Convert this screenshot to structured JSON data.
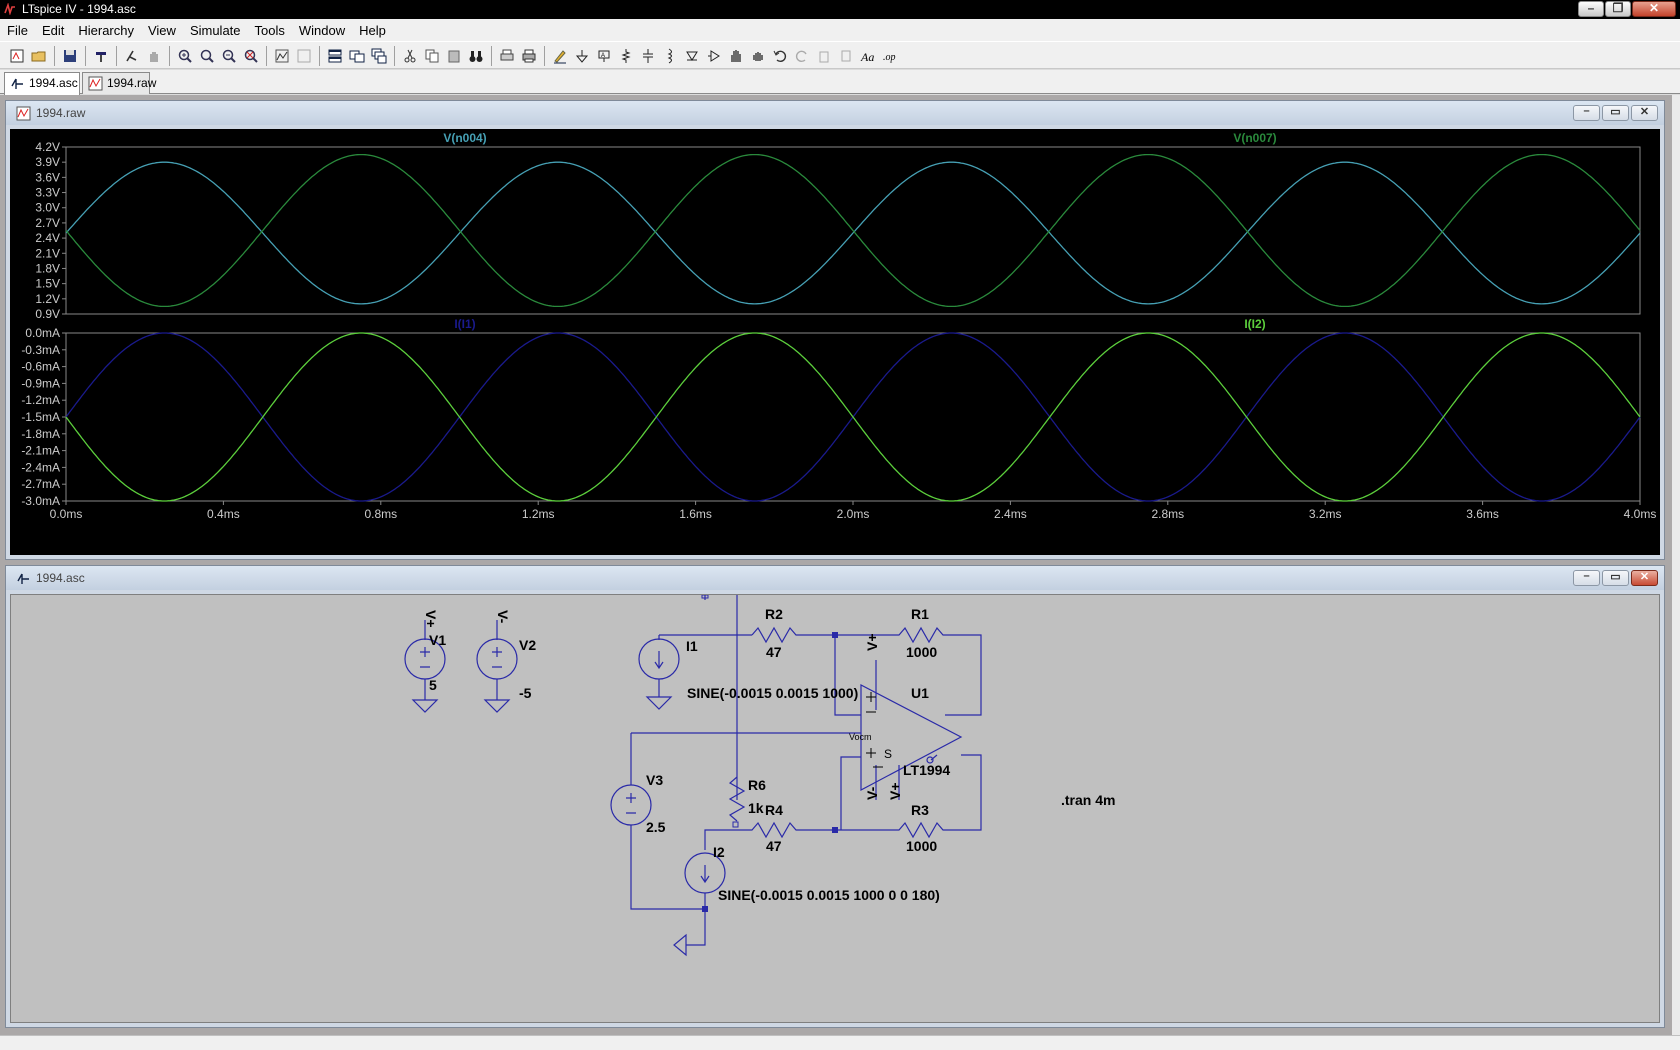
{
  "window": {
    "title": "LTspice IV - 1994.asc"
  },
  "menu": [
    "File",
    "Edit",
    "Hierarchy",
    "View",
    "Simulate",
    "Tools",
    "Window",
    "Help"
  ],
  "tabs": [
    {
      "label": "1994.asc",
      "active": true
    },
    {
      "label": "1994.raw",
      "active": false
    }
  ],
  "waveform_window": {
    "title": "1994.raw"
  },
  "schematic_window": {
    "title": "1994.asc"
  },
  "chart_data": [
    {
      "type": "line",
      "title": "",
      "xlabel": "",
      "ylabel": "",
      "x_ticks": [
        "0.0ms",
        "0.4ms",
        "0.8ms",
        "1.2ms",
        "1.6ms",
        "2.0ms",
        "2.4ms",
        "2.8ms",
        "3.2ms",
        "3.6ms",
        "4.0ms"
      ],
      "y_ticks": [
        "4.2V",
        "3.9V",
        "3.6V",
        "3.3V",
        "3.0V",
        "2.7V",
        "2.4V",
        "2.1V",
        "1.8V",
        "1.5V",
        "1.2V",
        "0.9V"
      ],
      "xlim_ms": [
        0,
        4
      ],
      "ylim": [
        0.9,
        4.2
      ],
      "grid": false,
      "series": [
        {
          "name": "V(n004)",
          "color": "#46a0b4",
          "offset": 2.5,
          "amplitude": 1.4,
          "freq_khz": 1,
          "phase_deg": 0
        },
        {
          "name": "V(n007)",
          "color": "#2a8a3c",
          "offset": 2.55,
          "amplitude": 1.5,
          "freq_khz": 1,
          "phase_deg": 180
        }
      ]
    },
    {
      "type": "line",
      "title": "",
      "xlabel": "",
      "ylabel": "",
      "x_ticks": [
        "0.0ms",
        "0.4ms",
        "0.8ms",
        "1.2ms",
        "1.6ms",
        "2.0ms",
        "2.4ms",
        "2.8ms",
        "3.2ms",
        "3.6ms",
        "4.0ms"
      ],
      "y_ticks": [
        "0.0mA",
        "-0.3mA",
        "-0.6mA",
        "-0.9mA",
        "-1.2mA",
        "-1.5mA",
        "-1.8mA",
        "-2.1mA",
        "-2.4mA",
        "-2.7mA",
        "-3.0mA"
      ],
      "xlim_ms": [
        0,
        4
      ],
      "ylim": [
        -3.0,
        0.0
      ],
      "grid": false,
      "series": [
        {
          "name": "I(I1)",
          "color": "#1a1a8c",
          "offset": -1.5,
          "amplitude": 1.5,
          "freq_khz": 1,
          "phase_deg": 0
        },
        {
          "name": "I(I2)",
          "color": "#5ccf3c",
          "offset": -1.5,
          "amplitude": 1.5,
          "freq_khz": 1,
          "phase_deg": 180
        }
      ]
    }
  ],
  "schematic": {
    "labels": {
      "v1": "V1",
      "v1_val": "5",
      "v1_net": "V+",
      "v2": "V2",
      "v2_val": "-5",
      "v2_net": "V-",
      "i1": "I1",
      "i1_val": "SINE(-0.0015 0.0015 1000)",
      "r2": "R2",
      "r2_val": "47",
      "r1": "R1",
      "r1_val": "1000",
      "u1": "U1",
      "u1_part": "LT1994",
      "vplus_top": "V+",
      "v3": "V3",
      "v3_val": "2.5",
      "r6": "R6",
      "r6_val": "1k",
      "r4": "R4",
      "r4_val": "47",
      "r3": "R3",
      "r3_val": "1000",
      "vminus_pin": "V-",
      "vplus_pin": "V+",
      "vocm": "Vocm",
      "i2": "I2",
      "i2_val": "SINE(-0.0015 0.0015 1000 0 0 180)",
      "tran": ".tran 4m",
      "shdn": "S"
    }
  }
}
